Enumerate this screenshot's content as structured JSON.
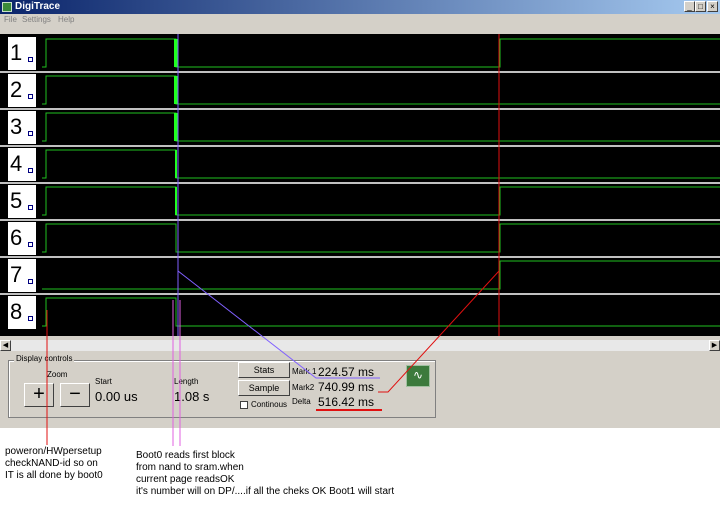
{
  "window": {
    "title": "DigiTrace",
    "controls": [
      "_",
      "□",
      "×"
    ]
  },
  "menu": [
    {
      "label": "File"
    },
    {
      "label": "Settings"
    },
    {
      "label": "Help"
    }
  ],
  "channels": [
    "1",
    "2",
    "3",
    "4",
    "5",
    "6",
    "7",
    "8"
  ],
  "display_controls": {
    "label": "Display controls",
    "zoom_label": "Zoom",
    "zoom_in": "+",
    "zoom_out": "−",
    "start_label": "Start",
    "start_value": "0.00 us",
    "length_label": "Length",
    "length_value": "1.08 s",
    "stats_button": "Stats",
    "sample_button": "Sample",
    "continuous_label": "Continous"
  },
  "markers": {
    "mark1_label": "Mark 1",
    "mark1_value": "224.57 ms",
    "mark2_label": "Mark2",
    "mark2_value": "740.99 ms",
    "delta_label": "Delta",
    "delta_value": "516.42 ms"
  },
  "annotations": {
    "left": [
      "poweron/HWpersetup",
      "checkNAND-id  so on",
      "IT is all done by boot0"
    ],
    "right": [
      "Boot0 reads first block",
      "from nand to sram.when",
      "current page readsOK",
      "it's number will on DP/....if all the cheks OK Boot1 will start"
    ]
  },
  "colors": {
    "trace": "#20c020",
    "mark1": "#8060ff",
    "mark2": "#e01010",
    "annotation": "#e060e0"
  }
}
